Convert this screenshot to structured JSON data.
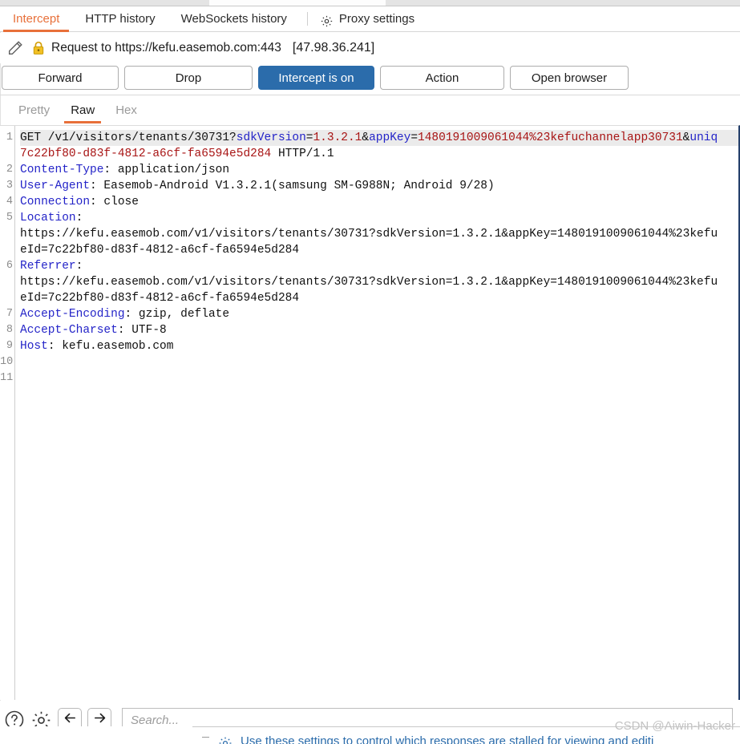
{
  "window": {
    "outer_tab_hint": ""
  },
  "subtabs": {
    "items": [
      {
        "label": "Intercept",
        "active": true
      },
      {
        "label": "HTTP history",
        "active": false
      },
      {
        "label": "WebSockets history",
        "active": false
      }
    ],
    "settings_label": "Proxy settings",
    "settings_icon": "gear-icon",
    "active_color": "#e8703a"
  },
  "request_header": {
    "edit_icon": "pencil-icon",
    "lock_icon": "lock-icon",
    "text": "Request to https://kefu.easemob.com:443",
    "ip": "[47.98.36.241]"
  },
  "buttons": {
    "forward": "Forward",
    "drop": "Drop",
    "intercept_toggle": "Intercept is on",
    "intercept_toggle_color": "#2b6cab",
    "action": "Action",
    "open_browser": "Open browser"
  },
  "view_tabs": {
    "items": [
      {
        "label": "Pretty",
        "active": false
      },
      {
        "label": "Raw",
        "active": true
      },
      {
        "label": "Hex",
        "active": false
      }
    ]
  },
  "editor": {
    "line_numbers": [
      "1",
      "2",
      "3",
      "4",
      "5",
      "6",
      "7",
      "8",
      "9",
      "10",
      "11"
    ],
    "colors": {
      "header_name": "#2424c8",
      "param_name": "#2424c8",
      "param_value": "#a81515",
      "plain": "#111111",
      "current_line_bg": "#ebebeb"
    },
    "lines": [
      {
        "num": "1",
        "highlight": true,
        "segments": [
          {
            "t": "GET /v1/visitors/tenants/30731?",
            "c": "plain"
          },
          {
            "t": "sdkVersion",
            "c": "param"
          },
          {
            "t": "=",
            "c": "plain"
          },
          {
            "t": "1.3.2.1",
            "c": "value"
          },
          {
            "t": "&",
            "c": "plain"
          },
          {
            "t": "appKey",
            "c": "param"
          },
          {
            "t": "=",
            "c": "plain"
          },
          {
            "t": "1480191009061044%23kefuchannelapp30731",
            "c": "value"
          },
          {
            "t": "&",
            "c": "plain"
          },
          {
            "t": "uniq",
            "c": "param"
          }
        ]
      },
      {
        "num": "",
        "highlight": false,
        "segments": [
          {
            "t": "7c22bf80-d83f-4812-a6cf-fa6594e5d284",
            "c": "value"
          },
          {
            "t": " HTTP/1.1",
            "c": "plain"
          }
        ]
      },
      {
        "num": "2",
        "highlight": false,
        "segments": [
          {
            "t": "Content-Type",
            "c": "header"
          },
          {
            "t": ": application/json",
            "c": "plain"
          }
        ]
      },
      {
        "num": "3",
        "highlight": false,
        "segments": [
          {
            "t": "User-Agent",
            "c": "header"
          },
          {
            "t": ": Easemob-Android V1.3.2.1(samsung SM-G988N; Android 9/28)",
            "c": "plain"
          }
        ]
      },
      {
        "num": "4",
        "highlight": false,
        "segments": [
          {
            "t": "Connection",
            "c": "header"
          },
          {
            "t": ": close",
            "c": "plain"
          }
        ]
      },
      {
        "num": "5",
        "highlight": false,
        "segments": [
          {
            "t": "Location",
            "c": "header"
          },
          {
            "t": ":",
            "c": "plain"
          }
        ]
      },
      {
        "num": "",
        "highlight": false,
        "segments": [
          {
            "t": "https://kefu.easemob.com/v1/visitors/tenants/30731?sdkVersion=1.3.2.1&appKey=1480191009061044%23kefu",
            "c": "plain"
          }
        ]
      },
      {
        "num": "",
        "highlight": false,
        "segments": [
          {
            "t": "eId=7c22bf80-d83f-4812-a6cf-fa6594e5d284",
            "c": "plain"
          }
        ]
      },
      {
        "num": "6",
        "highlight": false,
        "segments": [
          {
            "t": "Referrer",
            "c": "header"
          },
          {
            "t": ":",
            "c": "plain"
          }
        ]
      },
      {
        "num": "",
        "highlight": false,
        "segments": [
          {
            "t": "https://kefu.easemob.com/v1/visitors/tenants/30731?sdkVersion=1.3.2.1&appKey=1480191009061044%23kefu",
            "c": "plain"
          }
        ]
      },
      {
        "num": "",
        "highlight": false,
        "segments": [
          {
            "t": "eId=7c22bf80-d83f-4812-a6cf-fa6594e5d284",
            "c": "plain"
          }
        ]
      },
      {
        "num": "7",
        "highlight": false,
        "segments": [
          {
            "t": "Accept-Encoding",
            "c": "header"
          },
          {
            "t": ": gzip, deflate",
            "c": "plain"
          }
        ]
      },
      {
        "num": "8",
        "highlight": false,
        "segments": [
          {
            "t": "Accept-Charset",
            "c": "header"
          },
          {
            "t": ": UTF-8",
            "c": "plain"
          }
        ]
      },
      {
        "num": "9",
        "highlight": false,
        "segments": [
          {
            "t": "Host",
            "c": "header"
          },
          {
            "t": ": kefu.easemob.com",
            "c": "plain"
          }
        ]
      },
      {
        "num": "10",
        "highlight": false,
        "segments": []
      },
      {
        "num": "11",
        "highlight": false,
        "segments": []
      }
    ]
  },
  "bottom_bar": {
    "help_icon": "question-circle-icon",
    "settings_icon": "gear-icon",
    "back_icon": "arrow-left-icon",
    "forward_icon": "arrow-right-icon",
    "search_placeholder": "Search...",
    "search_value": ""
  },
  "background_window": {
    "text": "Use these settings to control which responses are stalled for viewing and editi",
    "icon": "gear-icon"
  },
  "watermark": {
    "text": "CSDN @Aiwin-Hacker"
  }
}
